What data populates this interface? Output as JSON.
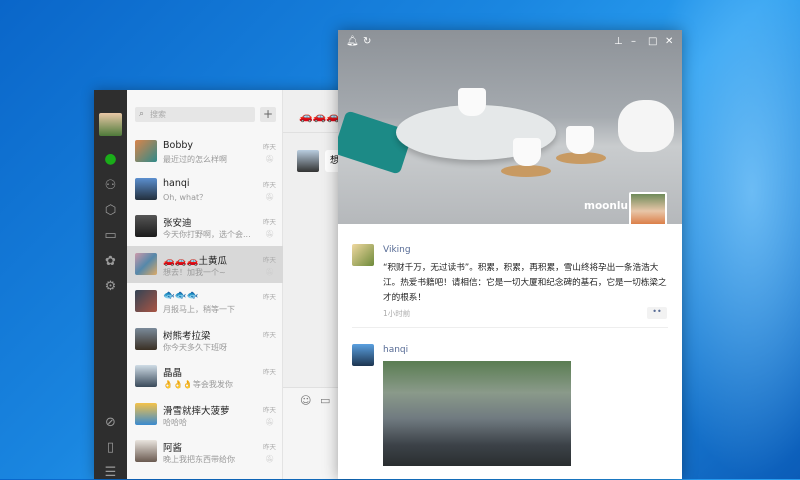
{
  "wechat": {
    "search_placeholder": "搜索",
    "add_label": "+",
    "nav_icons": [
      "chat-icon",
      "contacts-icon",
      "cube-icon",
      "folder-icon",
      "moments-icon",
      "settings-icon",
      "mini-program-icon",
      "phone-icon",
      "menu-icon"
    ],
    "chats": [
      {
        "name": "Bobby",
        "message": "最近过的怎么样啊",
        "time": "昨天",
        "muted": true
      },
      {
        "name": "hanqi",
        "message": "Oh, what？",
        "time": "昨天",
        "muted": true
      },
      {
        "name": "张安迪",
        "message": "今天你打野啊，选个会...",
        "time": "昨天",
        "muted": true
      },
      {
        "name": "🚗🚗🚗土黄瓜",
        "message": "想去！加我一个~",
        "time": "昨天",
        "muted": true,
        "selected": true
      },
      {
        "name": "🐟🐟🐟",
        "message": "月报马上，稍等一下",
        "time": "昨天",
        "muted": false
      },
      {
        "name": "树熊考拉梁",
        "message": "你今天多久下班呀",
        "time": "昨天",
        "muted": false
      },
      {
        "name": "晶晶",
        "message": "👌👌👌等会我发你",
        "time": "昨天",
        "muted": false
      },
      {
        "name": "滑雪就摔大菠萝",
        "message": "哈哈哈",
        "time": "昨天",
        "muted": true
      },
      {
        "name": "阿酱",
        "message": "晚上我把东西带给你",
        "time": "昨天",
        "muted": true
      }
    ],
    "chat_title": "🚗🚗🚗",
    "bubble_text": "想"
  },
  "moments": {
    "owner": "moonlu",
    "posts": [
      {
        "author": "Viking",
        "text": "“积财千万，无过读书”。积累，积累，再积累，雪山终将孕出一条浩浩大江。热爱书籍吧！请相信：它是一切大厦和纪念碑的基石，它是一切栋梁之才的根系！",
        "time": "1小时前",
        "more": "••"
      },
      {
        "author": "hanqi"
      }
    ]
  }
}
